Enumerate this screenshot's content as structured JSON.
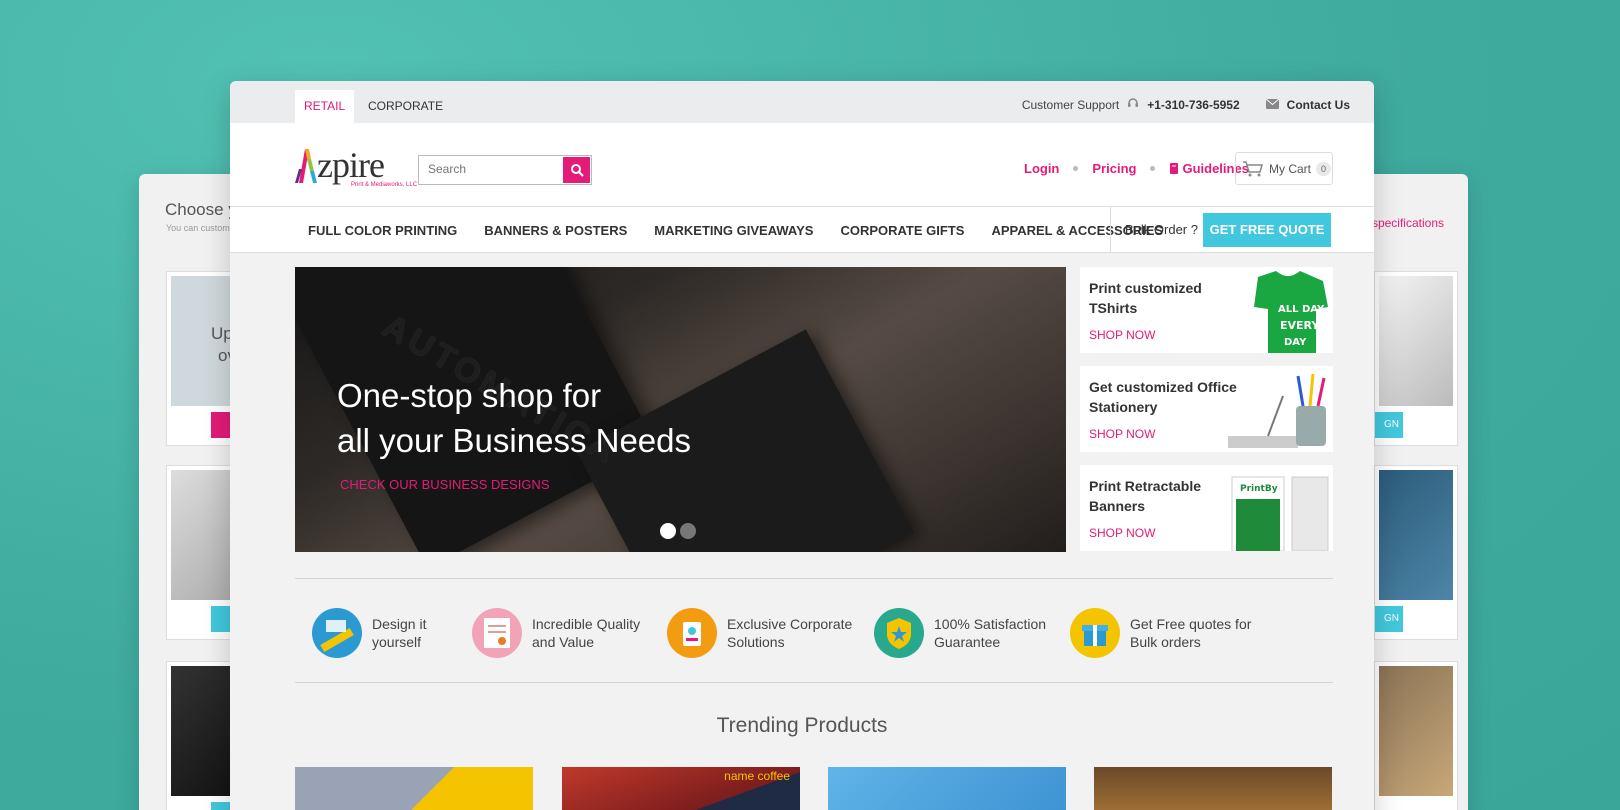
{
  "colors": {
    "accent": "#e41b77",
    "cta": "#42c8de",
    "background": "#45b5a8"
  },
  "back_window": {
    "title": "Choose y",
    "subtitle": "You can custom",
    "specs_link": "specifications",
    "card_text_1": "Up",
    "card_text_2": "ov",
    "button_label_1": "GN",
    "button_label_2": "GN"
  },
  "topbar": {
    "tabs": [
      {
        "label": "RETAIL"
      },
      {
        "label": "CORPORATE"
      }
    ],
    "support_label": "Customer Support",
    "phone": "+1-310-736-5952",
    "contact_label": "Contact Us",
    "headset_icon": "headset-icon",
    "mail_icon": "envelope-icon"
  },
  "header": {
    "logo_text": "zpire",
    "logo_tagline": "Print & Mediaworks, LLC",
    "search_placeholder": "Search",
    "links": {
      "login": "Login",
      "pricing": "Pricing",
      "guidelines": "Guidelines"
    },
    "cart_label": "My Cart",
    "cart_count": "0"
  },
  "nav": {
    "items": [
      {
        "label": "FULL COLOR PRINTING"
      },
      {
        "label": "BANNERS & POSTERS"
      },
      {
        "label": "MARKETING GIVEAWAYS"
      },
      {
        "label": "CORPORATE GIFTS"
      },
      {
        "label": "APPAREL & ACCESSORIES"
      }
    ],
    "bulk_label": "Bulk Order ?",
    "quote_label": "GET FREE QUOTE"
  },
  "hero": {
    "brand_text": "AUTOMATICA",
    "line1": "One-stop shop for",
    "line2": "all your Business Needs",
    "cta": "CHECK OUR BUSINESS DESIGNS",
    "slide_count": 2,
    "active_slide": 1
  },
  "promos": [
    {
      "title": "Print customized TShirts",
      "link": "SHOP NOW",
      "shirt_line1": "ALL DAY",
      "shirt_line2": "EVERY",
      "shirt_line3": "DAY"
    },
    {
      "title": "Get customized Office Stationery",
      "link": "SHOP NOW"
    },
    {
      "title": "Print Retractable Banners",
      "link": "SHOP NOW",
      "banner_brand": "PrintBy"
    }
  ],
  "features": [
    {
      "label": "Design it yourself",
      "icon": "design-ruler-icon"
    },
    {
      "label": "Incredible Quality and Value",
      "icon": "certificate-icon"
    },
    {
      "label": "Exclusive Corporate Solutions",
      "icon": "id-badge-icon"
    },
    {
      "label": "100% Satisfaction Guarantee",
      "icon": "shield-star-icon"
    },
    {
      "label": "Get Free quotes for Bulk orders",
      "icon": "gift-icon"
    }
  ],
  "trending": {
    "title": "Trending Products",
    "product_2_text": "name coffee"
  }
}
